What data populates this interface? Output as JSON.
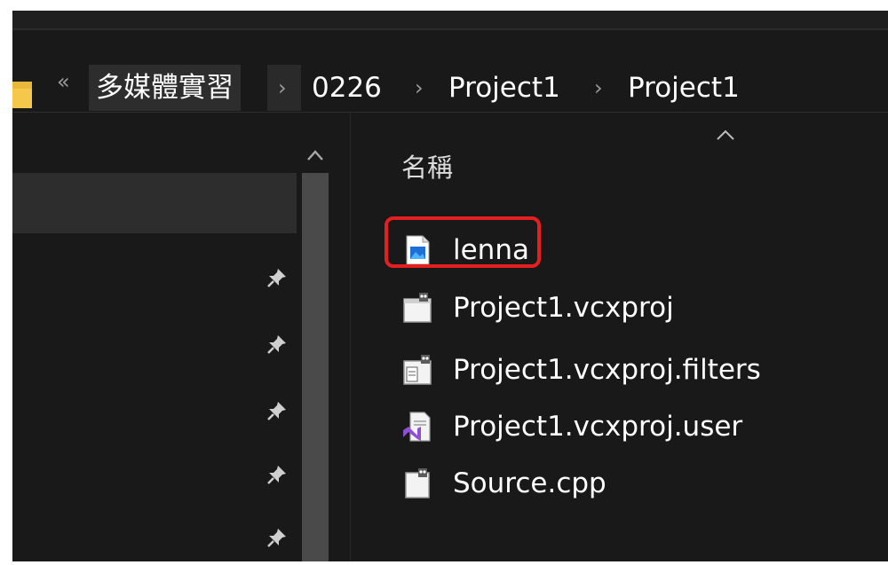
{
  "breadcrumb": {
    "overflow_glyph": "«",
    "separator_glyph": "›",
    "items": [
      {
        "label": "多媒體實習"
      },
      {
        "label": "0226"
      },
      {
        "label": "Project1"
      },
      {
        "label": "Project1"
      }
    ]
  },
  "file_list": {
    "column_header": "名稱",
    "items": [
      {
        "name": "lenna",
        "icon": "image-file-icon"
      },
      {
        "name": "Project1.vcxproj",
        "icon": "project-file-icon"
      },
      {
        "name": "Project1.vcxproj.filters",
        "icon": "filters-file-icon"
      },
      {
        "name": "Project1.vcxproj.user",
        "icon": "visual-studio-user-file-icon"
      },
      {
        "name": "Source.cpp",
        "icon": "cpp-source-file-icon"
      }
    ]
  },
  "colors": {
    "background": "#191919",
    "hover": "#2d2d2d",
    "highlight": "#e51f1f",
    "scrollbar": "#4a4a4a"
  }
}
